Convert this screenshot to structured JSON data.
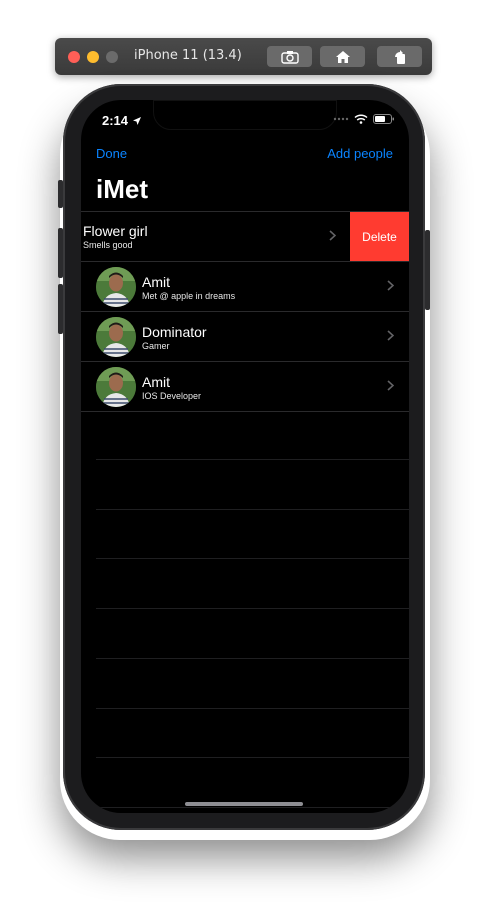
{
  "simulator": {
    "title": "iPhone 11 (13.4)"
  },
  "status_bar": {
    "time": "2:14"
  },
  "nav": {
    "done_label": "Done",
    "add_label": "Add people",
    "title": "iMet"
  },
  "rows": [
    {
      "name": "Flower girl",
      "subtitle": "Smells good"
    },
    {
      "name": "Amit",
      "subtitle": "Met @ apple in dreams"
    },
    {
      "name": "Dominator",
      "subtitle": "Gamer"
    },
    {
      "name": "Amit",
      "subtitle": "IOS Developer"
    }
  ],
  "swipe_action": {
    "delete_label": "Delete",
    "color": "#ff3b30"
  },
  "colors": {
    "accent": "#0a84ff",
    "background": "#000000"
  }
}
